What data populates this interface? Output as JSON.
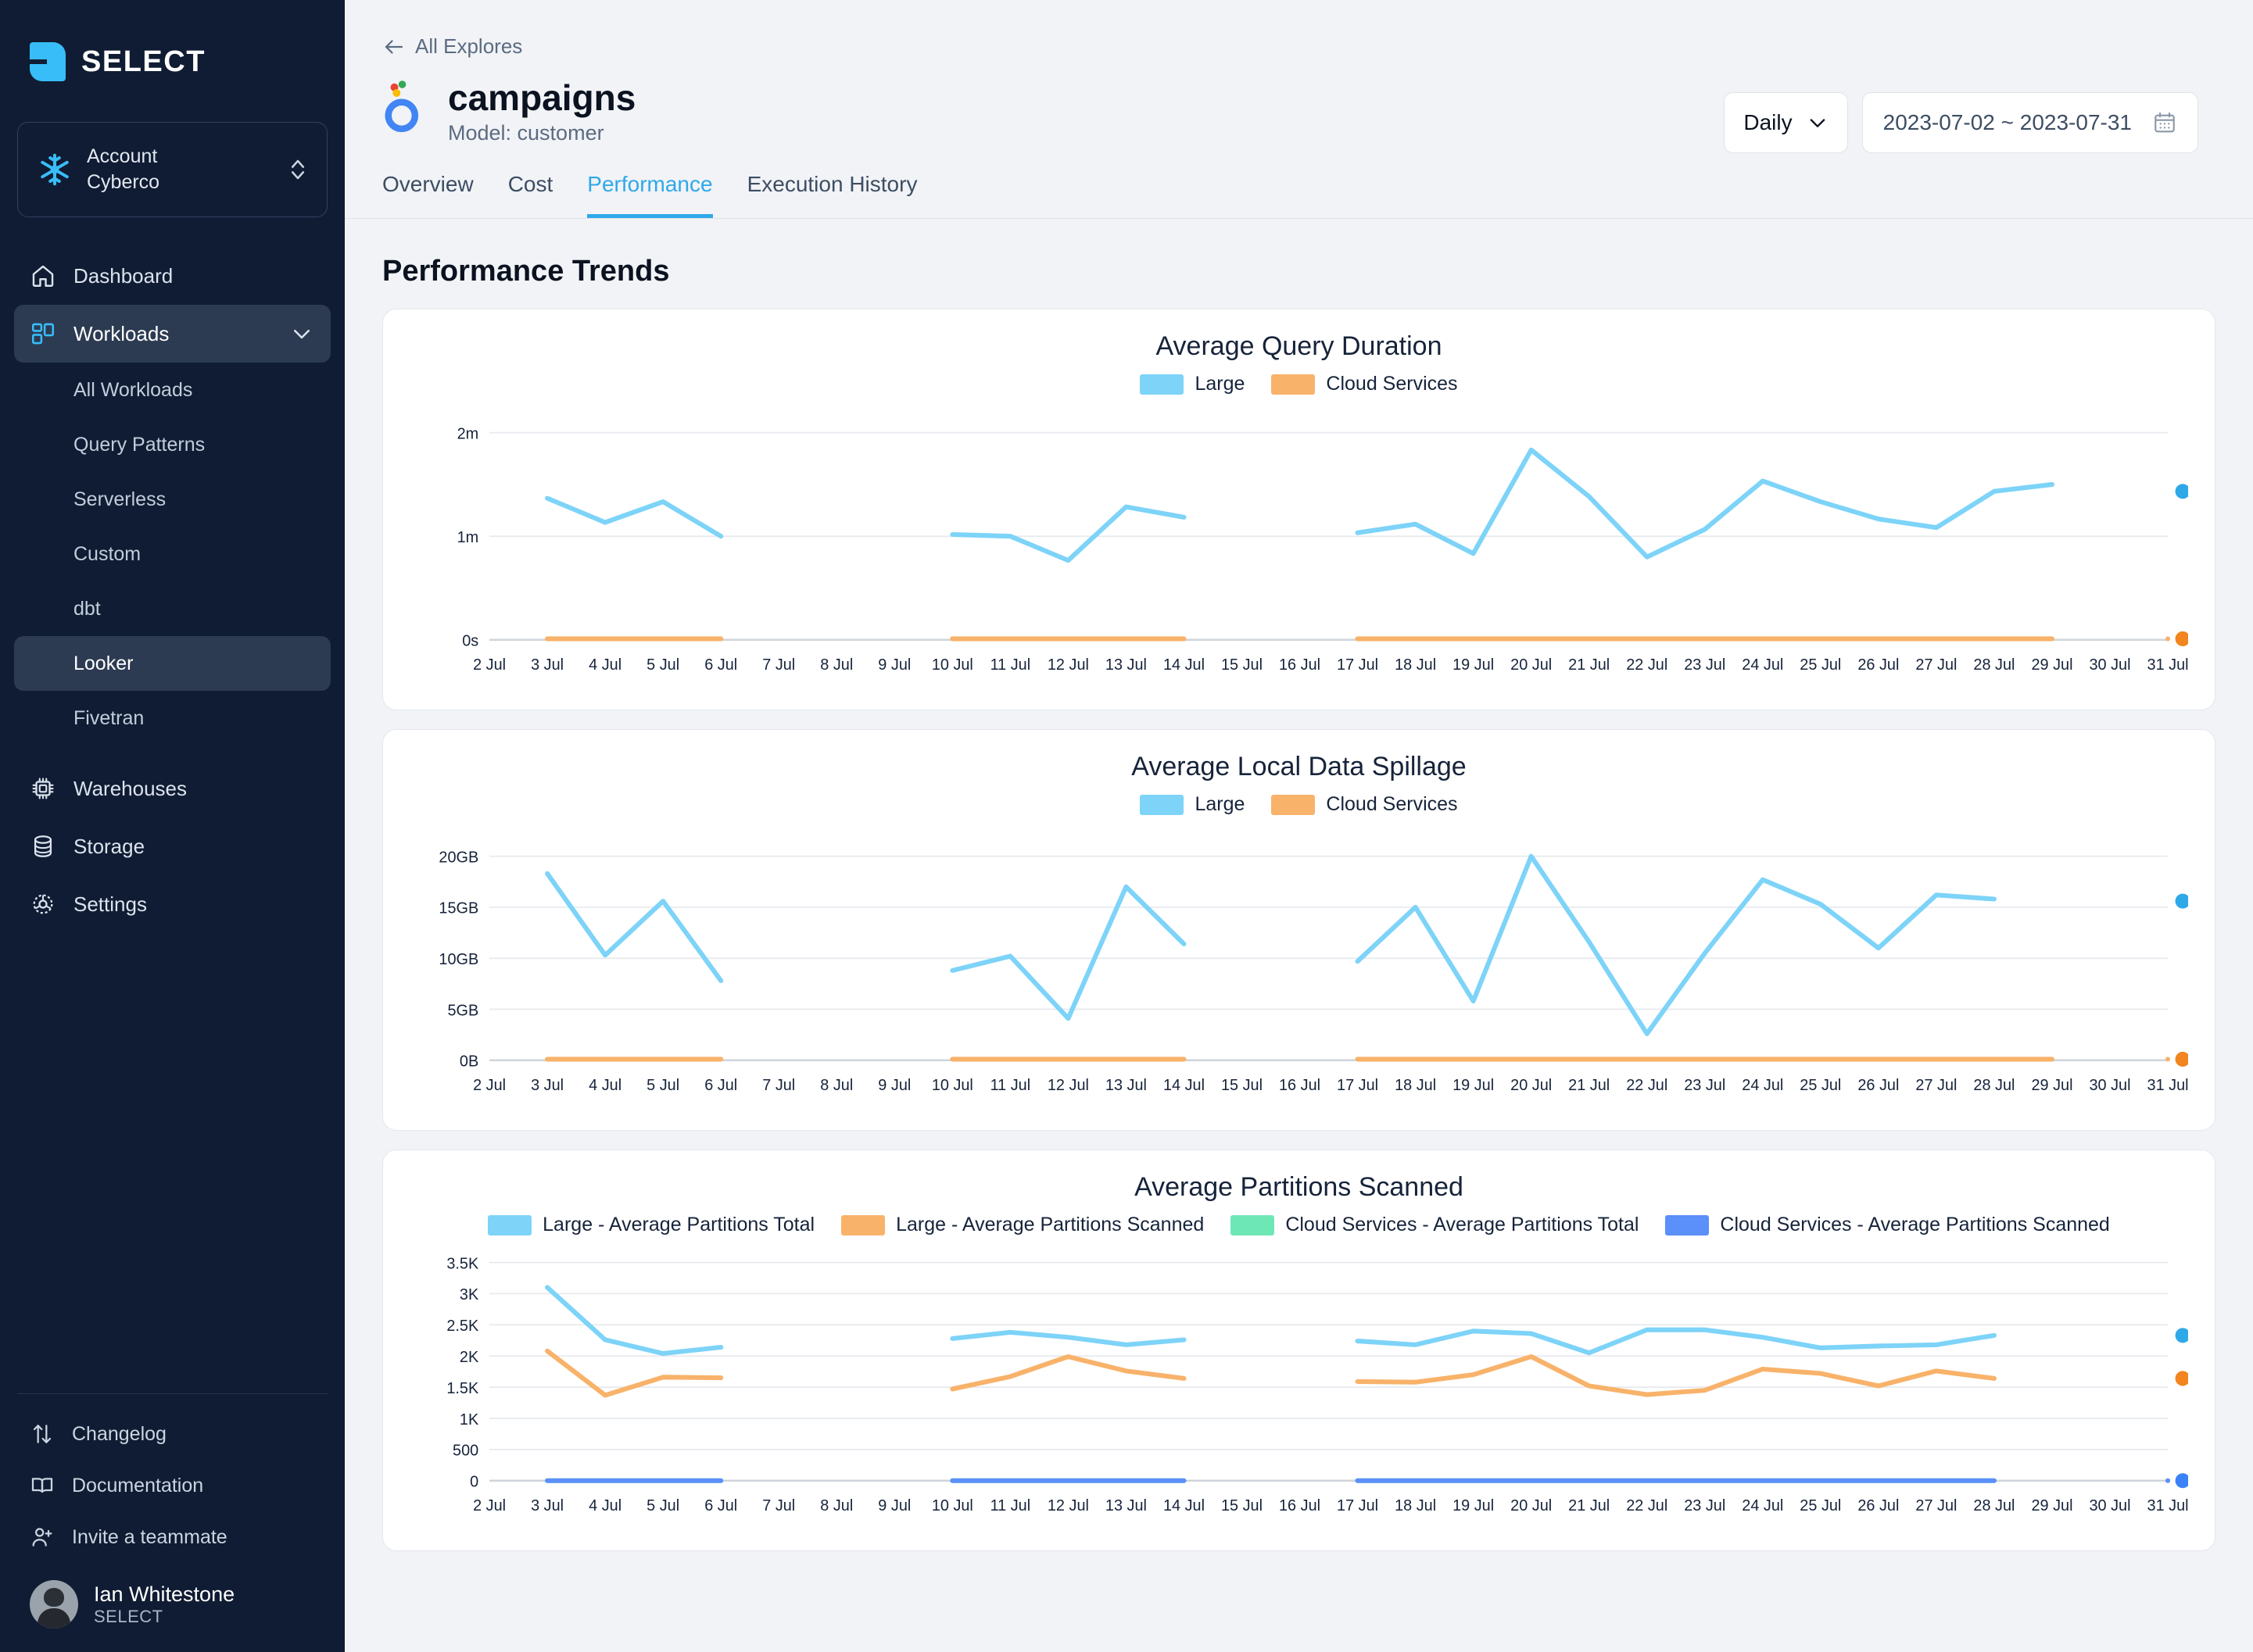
{
  "sidebar": {
    "brand": "SELECT",
    "account": {
      "label": "Account",
      "value": "Cyberco"
    },
    "nav": [
      {
        "label": "Dashboard",
        "icon": "home-icon",
        "active": false
      },
      {
        "label": "Workloads",
        "icon": "workloads-icon",
        "active": true,
        "expanded": true
      }
    ],
    "workload_children": [
      {
        "label": "All Workloads",
        "active": false
      },
      {
        "label": "Query Patterns",
        "active": false
      },
      {
        "label": "Serverless",
        "active": false
      },
      {
        "label": "Custom",
        "active": false
      },
      {
        "label": "dbt",
        "active": false
      },
      {
        "label": "Looker",
        "active": true
      },
      {
        "label": "Fivetran",
        "active": false
      }
    ],
    "nav_rest": [
      {
        "label": "Warehouses",
        "icon": "chip-icon"
      },
      {
        "label": "Storage",
        "icon": "database-icon"
      },
      {
        "label": "Settings",
        "icon": "gear-icon"
      }
    ],
    "bottom_links": [
      {
        "label": "Changelog",
        "icon": "updown-arrows-icon"
      },
      {
        "label": "Documentation",
        "icon": "book-icon"
      },
      {
        "label": "Invite a teammate",
        "icon": "user-plus-icon"
      }
    ],
    "user": {
      "name": "Ian Whitestone",
      "org": "SELECT"
    }
  },
  "header": {
    "back_label": "All Explores",
    "title": "campaigns",
    "subtitle": "Model: customer",
    "granularity": "Daily",
    "date_range": "2023-07-02 ~ 2023-07-31",
    "tabs": [
      {
        "label": "Overview",
        "active": false
      },
      {
        "label": "Cost",
        "active": false
      },
      {
        "label": "Performance",
        "active": true
      },
      {
        "label": "Execution History",
        "active": false
      }
    ]
  },
  "main": {
    "section_title": "Performance Trends"
  },
  "colors": {
    "accent": "#2fa8e8",
    "large_blue": "#7dd3f8",
    "cloud_orange": "#f8b26a",
    "green": "#6ee7b7",
    "royal_blue": "#5b8ff9",
    "dot_blue": "#2fa8e8",
    "dot_orange": "#f2851f"
  },
  "chart_data": [
    {
      "type": "line",
      "title": "Average Query Duration",
      "xlabel": "",
      "ylabel": "",
      "grid": true,
      "legend_position": "top",
      "legend": [
        {
          "name": "Large",
          "color": "#7dd3f8"
        },
        {
          "name": "Cloud Services",
          "color": "#f8b26a"
        }
      ],
      "categories": [
        "2 Jul",
        "3 Jul",
        "4 Jul",
        "5 Jul",
        "6 Jul",
        "7 Jul",
        "8 Jul",
        "9 Jul",
        "10 Jul",
        "11 Jul",
        "12 Jul",
        "13 Jul",
        "14 Jul",
        "15 Jul",
        "16 Jul",
        "17 Jul",
        "18 Jul",
        "19 Jul",
        "20 Jul",
        "21 Jul",
        "22 Jul",
        "23 Jul",
        "24 Jul",
        "25 Jul",
        "26 Jul",
        "27 Jul",
        "28 Jul",
        "29 Jul",
        "30 Jul",
        "31 Jul"
      ],
      "ytick_labels": [
        "0s",
        "1m",
        "2m"
      ],
      "ytick_values": [
        0,
        60,
        120
      ],
      "ylim": [
        0,
        130
      ],
      "series": [
        {
          "name": "Large",
          "color": "#7dd3f8",
          "values": [
            null,
            82,
            68,
            80,
            60,
            null,
            null,
            null,
            61,
            60,
            46,
            77,
            71,
            null,
            null,
            62,
            67,
            50,
            110,
            83,
            48,
            64,
            92,
            80,
            70,
            65,
            86,
            90,
            null,
            null
          ]
        },
        {
          "name": "Cloud Services",
          "color": "#f8b26a",
          "values": [
            null,
            0.6,
            0.6,
            0.6,
            0.6,
            null,
            null,
            null,
            0.6,
            0.6,
            0.6,
            0.6,
            0.6,
            null,
            null,
            0.6,
            0.6,
            0.6,
            0.6,
            0.6,
            0.6,
            0.6,
            0.6,
            0.6,
            0.6,
            0.6,
            0.6,
            0.6,
            null,
            0.6
          ]
        }
      ],
      "end_markers": [
        {
          "series": "Large",
          "color": "#2fa8e8",
          "value": 86
        },
        {
          "series": "Cloud Services",
          "color": "#f2851f",
          "value": 0.6
        }
      ]
    },
    {
      "type": "line",
      "title": "Average Local Data Spillage",
      "xlabel": "",
      "ylabel": "",
      "grid": true,
      "legend_position": "top",
      "legend": [
        {
          "name": "Large",
          "color": "#7dd3f8"
        },
        {
          "name": "Cloud Services",
          "color": "#f8b26a"
        }
      ],
      "categories": [
        "2 Jul",
        "3 Jul",
        "4 Jul",
        "5 Jul",
        "6 Jul",
        "7 Jul",
        "8 Jul",
        "9 Jul",
        "10 Jul",
        "11 Jul",
        "12 Jul",
        "13 Jul",
        "14 Jul",
        "15 Jul",
        "16 Jul",
        "17 Jul",
        "18 Jul",
        "19 Jul",
        "20 Jul",
        "21 Jul",
        "22 Jul",
        "23 Jul",
        "24 Jul",
        "25 Jul",
        "26 Jul",
        "27 Jul",
        "28 Jul",
        "29 Jul",
        "30 Jul",
        "31 Jul"
      ],
      "ytick_labels": [
        "0B",
        "5GB",
        "10GB",
        "15GB",
        "20GB"
      ],
      "ytick_values": [
        0,
        5,
        10,
        15,
        20
      ],
      "ylim": [
        0,
        22
      ],
      "series": [
        {
          "name": "Large",
          "color": "#7dd3f8",
          "values": [
            null,
            18.3,
            10.3,
            15.6,
            7.8,
            null,
            null,
            null,
            8.8,
            10.2,
            4.1,
            17.0,
            11.4,
            null,
            null,
            9.7,
            15.0,
            5.8,
            20.0,
            11.6,
            2.6,
            10.5,
            17.7,
            15.3,
            11.0,
            16.2,
            15.8,
            null,
            null,
            null
          ]
        },
        {
          "name": "Cloud Services",
          "color": "#f8b26a",
          "values": [
            null,
            0.1,
            0.1,
            0.1,
            0.1,
            null,
            null,
            null,
            0.1,
            0.1,
            0.1,
            0.1,
            0.1,
            null,
            null,
            0.1,
            0.1,
            0.1,
            0.1,
            0.1,
            0.1,
            0.1,
            0.1,
            0.1,
            0.1,
            0.1,
            0.1,
            0.1,
            null,
            0.1
          ]
        }
      ],
      "end_markers": [
        {
          "series": "Large",
          "color": "#2fa8e8",
          "value": 15.6
        },
        {
          "series": "Cloud Services",
          "color": "#f2851f",
          "value": 0.1
        }
      ]
    },
    {
      "type": "line",
      "title": "Average Partitions Scanned",
      "xlabel": "",
      "ylabel": "",
      "grid": true,
      "legend_position": "top",
      "legend": [
        {
          "name": "Large - Average Partitions Total",
          "color": "#7dd3f8"
        },
        {
          "name": "Large - Average Partitions Scanned",
          "color": "#f8b26a"
        },
        {
          "name": "Cloud Services - Average Partitions Total",
          "color": "#6ee7b7"
        },
        {
          "name": "Cloud Services - Average Partitions Scanned",
          "color": "#5b8ff9"
        }
      ],
      "categories": [
        "2 Jul",
        "3 Jul",
        "4 Jul",
        "5 Jul",
        "6 Jul",
        "7 Jul",
        "8 Jul",
        "9 Jul",
        "10 Jul",
        "11 Jul",
        "12 Jul",
        "13 Jul",
        "14 Jul",
        "15 Jul",
        "16 Jul",
        "17 Jul",
        "18 Jul",
        "19 Jul",
        "20 Jul",
        "21 Jul",
        "22 Jul",
        "23 Jul",
        "24 Jul",
        "25 Jul",
        "26 Jul",
        "27 Jul",
        "28 Jul",
        "29 Jul",
        "30 Jul",
        "31 Jul"
      ],
      "ytick_labels": [
        "0",
        "500",
        "1K",
        "1.5K",
        "2K",
        "2.5K",
        "3K",
        "3.5K"
      ],
      "ytick_values": [
        0,
        500,
        1000,
        1500,
        2000,
        2500,
        3000,
        3500
      ],
      "ylim": [
        0,
        3600
      ],
      "series": [
        {
          "name": "Large - Average Partitions Total",
          "color": "#7dd3f8",
          "values": [
            null,
            3100,
            2260,
            2040,
            2140,
            null,
            null,
            null,
            2280,
            2380,
            2300,
            2180,
            2260,
            null,
            null,
            2240,
            2180,
            2400,
            2360,
            2050,
            2420,
            2420,
            2300,
            2130,
            2160,
            2180,
            2330,
            null,
            null,
            null
          ]
        },
        {
          "name": "Large - Average Partitions Scanned",
          "color": "#f8b26a",
          "values": [
            null,
            2080,
            1370,
            1660,
            1650,
            null,
            null,
            null,
            1470,
            1670,
            1990,
            1760,
            1640,
            null,
            null,
            1590,
            1580,
            1700,
            1990,
            1520,
            1380,
            1450,
            1790,
            1720,
            1520,
            1760,
            1640,
            null,
            null,
            null
          ]
        },
        {
          "name": "Cloud Services - Average Partitions Total",
          "color": "#6ee7b7",
          "values": [
            null,
            0,
            0,
            0,
            0,
            null,
            null,
            null,
            0,
            0,
            0,
            0,
            0,
            null,
            null,
            0,
            0,
            0,
            0,
            0,
            0,
            0,
            0,
            0,
            0,
            0,
            0,
            null,
            null,
            0
          ]
        },
        {
          "name": "Cloud Services - Average Partitions Scanned",
          "color": "#5b8ff9",
          "values": [
            null,
            0,
            0,
            0,
            0,
            null,
            null,
            null,
            0,
            0,
            0,
            0,
            0,
            null,
            null,
            0,
            0,
            0,
            0,
            0,
            0,
            0,
            0,
            0,
            0,
            0,
            0,
            null,
            null,
            0
          ]
        }
      ],
      "end_markers": [
        {
          "series": "Large - Average Partitions Total",
          "color": "#2fa8e8",
          "value": 2330
        },
        {
          "series": "Large - Average Partitions Scanned",
          "color": "#f2851f",
          "value": 1640
        },
        {
          "series": "Cloud Services - Average Partitions Scanned",
          "color": "#3b82f6",
          "value": 0
        }
      ]
    }
  ]
}
